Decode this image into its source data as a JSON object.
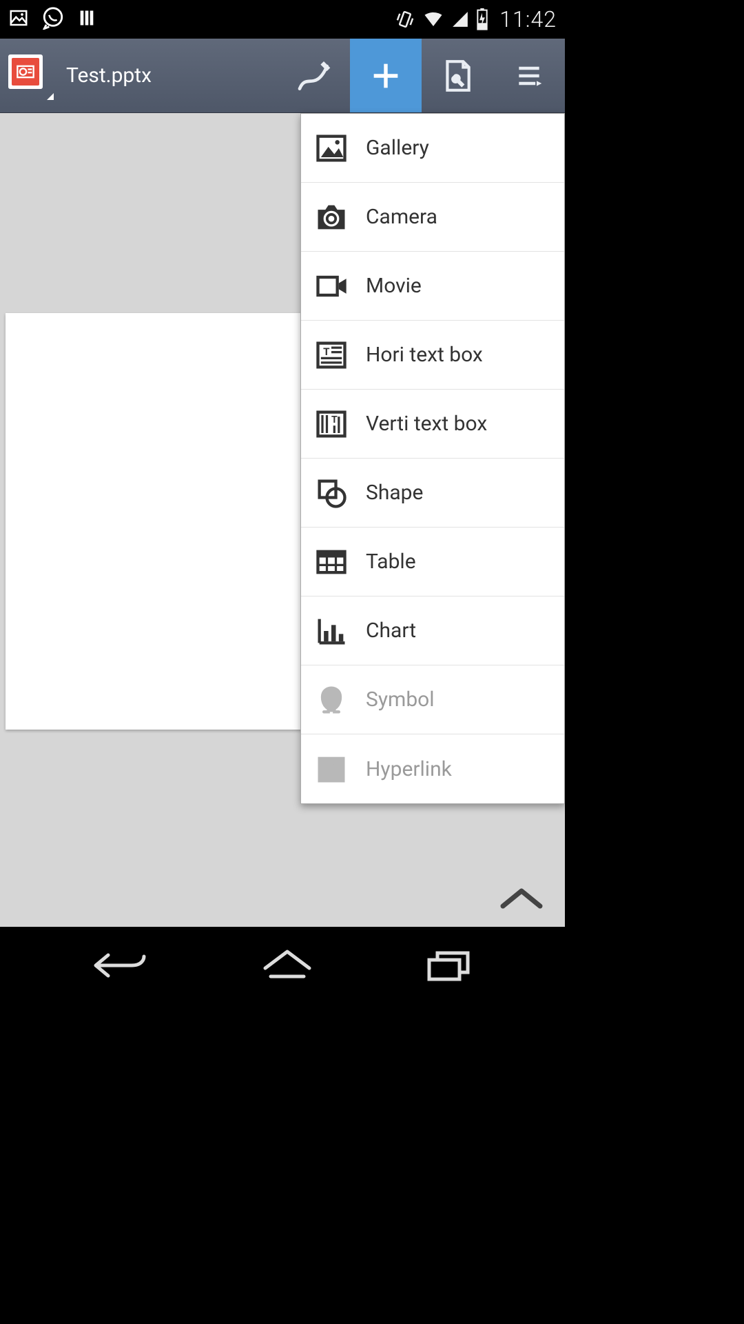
{
  "status": {
    "time": "11:42"
  },
  "toolbar": {
    "file_title": "Test.pptx"
  },
  "insert_menu": {
    "items": [
      {
        "label": "Gallery",
        "icon": "gallery-icon",
        "enabled": true
      },
      {
        "label": "Camera",
        "icon": "camera-icon",
        "enabled": true
      },
      {
        "label": "Movie",
        "icon": "movie-icon",
        "enabled": true
      },
      {
        "label": "Hori text box",
        "icon": "hori-text-icon",
        "enabled": true
      },
      {
        "label": "Verti text box",
        "icon": "verti-text-icon",
        "enabled": true
      },
      {
        "label": "Shape",
        "icon": "shape-icon",
        "enabled": true
      },
      {
        "label": "Table",
        "icon": "table-icon",
        "enabled": true
      },
      {
        "label": "Chart",
        "icon": "chart-icon",
        "enabled": true
      },
      {
        "label": "Symbol",
        "icon": "symbol-icon",
        "enabled": false
      },
      {
        "label": "Hyperlink",
        "icon": "hyperlink-icon",
        "enabled": false
      }
    ]
  }
}
